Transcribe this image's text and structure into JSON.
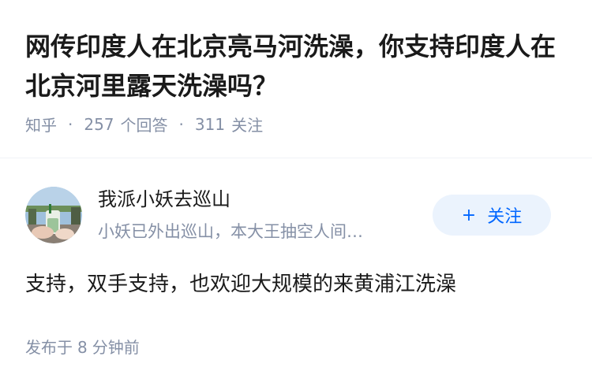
{
  "question": {
    "title": "网传印度人在北京亮马河洗澡，你支持印度人在北京河里露天洗澡吗？",
    "source": "知乎",
    "separator": "·",
    "answers_count": "257",
    "answers_label": "个回答",
    "followers_count": "311",
    "followers_label": "关注"
  },
  "answer": {
    "author_name": "我派小妖去巡山",
    "author_bio": "小妖已外出巡山，本大王抽空人间…",
    "follow_button": {
      "icon": "+",
      "label": "关注"
    },
    "content": "支持，双手支持，也欢迎大规模的来黄浦江洗澡",
    "time_prefix": "发布于",
    "time_value": "8",
    "time_unit": "分钟前",
    "avatar_icon": "user-avatar-photo"
  },
  "colors": {
    "accent": "#0066ff",
    "follow_bg": "#ebf3fd",
    "meta_text": "#8590a6",
    "title_text": "#1a1a1a"
  }
}
